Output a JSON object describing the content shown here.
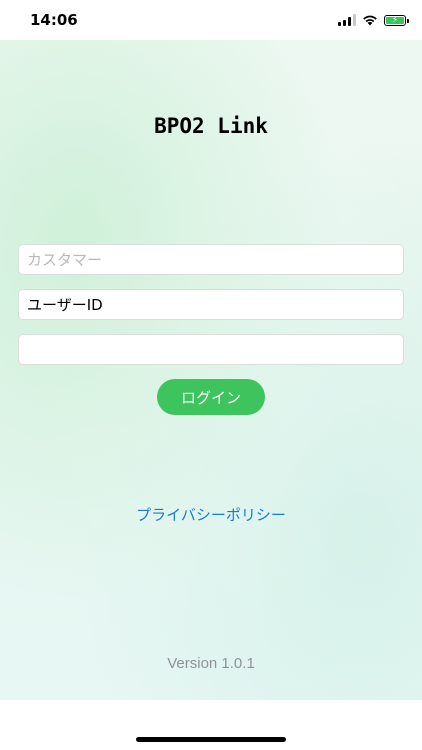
{
  "status_bar": {
    "time": "14:06",
    "icons": [
      "cellular-signal-icon",
      "wifi-icon",
      "battery-charging-icon"
    ],
    "battery_color": "#34c759"
  },
  "app": {
    "title": "BPO2 Link"
  },
  "form": {
    "customer": {
      "placeholder": "カスタマー",
      "value": ""
    },
    "user_id": {
      "placeholder": "",
      "value": "ユーザーID"
    },
    "password": {
      "placeholder": "",
      "value": ""
    },
    "login_label": "ログイン",
    "login_color": "#3dc45c"
  },
  "links": {
    "privacy_policy": "プライバシーポリシー",
    "link_color": "#1a7ad9"
  },
  "footer": {
    "version": "Version 1.0.1"
  }
}
